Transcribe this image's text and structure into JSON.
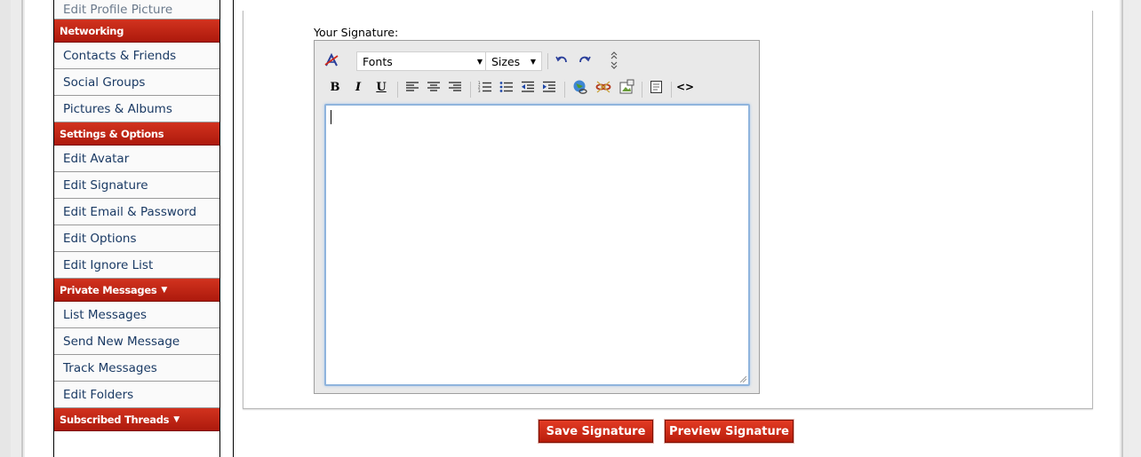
{
  "sidebar": {
    "items": [
      {
        "type": "item",
        "label": "Edit Profile Picture",
        "partial": true
      },
      {
        "type": "header",
        "label": "Networking",
        "arrow": false
      },
      {
        "type": "item",
        "label": "Contacts & Friends"
      },
      {
        "type": "item",
        "label": "Social Groups"
      },
      {
        "type": "item",
        "label": "Pictures & Albums"
      },
      {
        "type": "header",
        "label": "Settings & Options",
        "arrow": false
      },
      {
        "type": "item",
        "label": "Edit Avatar"
      },
      {
        "type": "item",
        "label": "Edit Signature"
      },
      {
        "type": "item",
        "label": "Edit Email & Password"
      },
      {
        "type": "item",
        "label": "Edit Options"
      },
      {
        "type": "item",
        "label": "Edit Ignore List"
      },
      {
        "type": "header",
        "label": "Private Messages",
        "arrow": true
      },
      {
        "type": "item",
        "label": "List Messages"
      },
      {
        "type": "item",
        "label": "Send New Message"
      },
      {
        "type": "item",
        "label": "Track Messages"
      },
      {
        "type": "item",
        "label": "Edit Folders"
      },
      {
        "type": "header",
        "label": "Subscribed Threads",
        "arrow": true
      }
    ]
  },
  "signature": {
    "label": "Your Signature:",
    "value": ""
  },
  "editor": {
    "fonts_label": "Fonts",
    "sizes_label": "Sizes",
    "bold": "B",
    "italic": "I",
    "underline": "U",
    "source": "<>"
  },
  "actions": {
    "save_label": "Save Signature",
    "preview_label": "Preview Signature"
  },
  "colors": {
    "accent_red": "#c62a18",
    "link_blue": "#1a3a64",
    "focus_blue": "#8fb4dd"
  }
}
